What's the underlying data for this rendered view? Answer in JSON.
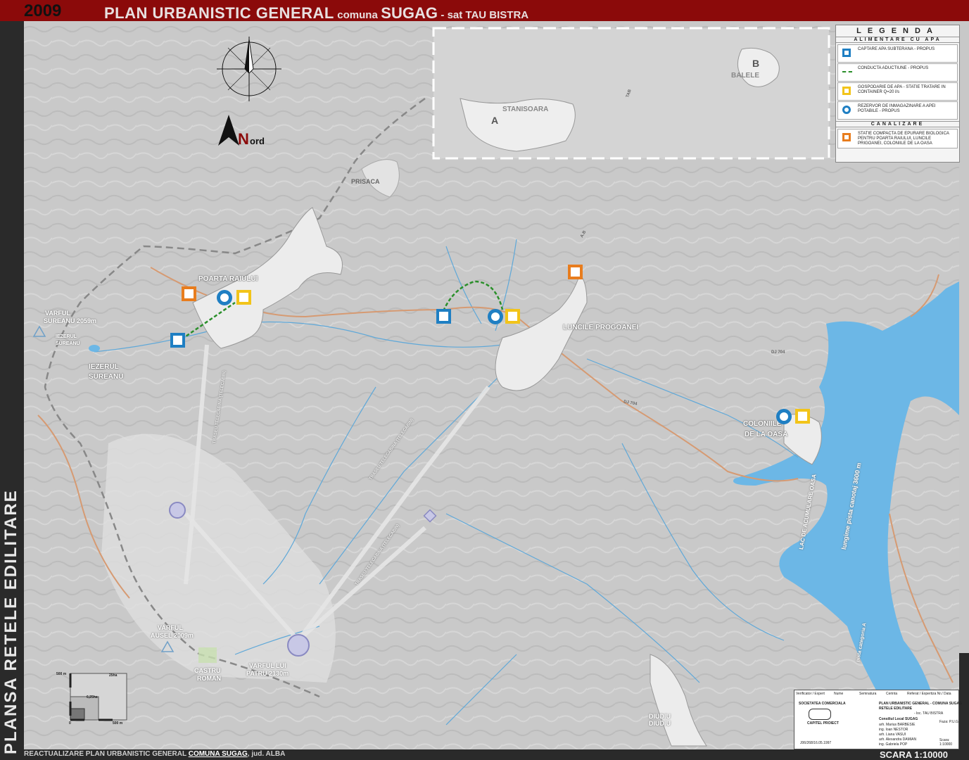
{
  "header": {
    "year": "2009",
    "title_main": "PLAN URBANISTIC GENERAL",
    "title_comuna_label": "comuna",
    "title_comuna": "SUGAG",
    "title_sat": "- sat TAU BISTRA"
  },
  "side_title": "PLANSA RETELE EDILITARE",
  "footer": {
    "left_prefix": "REACTUALIZARE PLAN URBANISTIC GENERAL",
    "left_comuna": "COMUNA SUGAG",
    "left_suffix": ", jud. ALBA",
    "scale": "SCARA 1:10000"
  },
  "legend": {
    "title": "LEGENDA",
    "section_water": "ALIMENTARE CU APA",
    "items_water": [
      {
        "icon": "blue-square-icon",
        "label": "CAPTARE APA SUBTERANA - PROPUS"
      },
      {
        "icon": "green-dashed-line-icon",
        "label": "CONDUCTA ADUCTIUNE - PROPUS"
      },
      {
        "icon": "yellow-square-icon",
        "label": "GOSPODARIE DE APA - STATIE TRATARE IN CONTAINER Q=20 l/s"
      },
      {
        "icon": "blue-circle-icon",
        "label": "REZERVOR DE INMAGAZINARE A APEI POTABILE - PROPUS"
      }
    ],
    "section_sewer": "CANALIZARE",
    "items_sewer": [
      {
        "icon": "orange-square-icon",
        "label": "STATIE COMPACTA DE EPURARE BIOLOGICA PENTRU POARTA RAIULUI, LUNCILE PRIGOANEI, COLONIILE DE LA OASA"
      }
    ]
  },
  "inset": {
    "area_a": "A",
    "area_a_name": "STANISOARA",
    "area_b": "B",
    "area_b_name": "BALELE",
    "road": "TAB"
  },
  "places": {
    "prisaca": "PRISACA",
    "poarta_raiului": "POARTA RAIULUI",
    "luncile_progoanei": "LUNCILE PROGOANEI",
    "coloniile": "COLONIILE",
    "de_la_oasa": "DE LA OASA",
    "varful_sureanu_1": "VARFUL",
    "varful_sureanu_2": "SUREANU 2059m",
    "iezerul_small_1": "IEZERUL",
    "iezerul_small_2": "SUREANU",
    "iezerul_1": "IEZERUL",
    "iezerul_2": "SUREANU",
    "varful_ausel_1": "VARFUL",
    "varful_ausel_2": "AUSEL 2009m",
    "castru_1": "CASTRU",
    "castru_2": "ROMAN",
    "varful_patru_1": "VARFUL LUI",
    "varful_patru_2": "PATRU 2130m",
    "diudiu_top": "DIUDIU",
    "diudiu_bottom": "DIUDIU",
    "lac": "LAC DE ACUMULARE OASA",
    "pista": "lungime pista canotaj 3600 m",
    "pista2": "pista categoria A",
    "road_dj704": "DJ 704",
    "road_dj704b": "DJ 704",
    "road_ab": "A.B",
    "telecabina1": "TRASEU TELECABINA (TELECABIN)",
    "telecabina2": "TRASEU TELECABINA (TELECABIN)",
    "telecabina3": "TRASEU TELECABINA (TELECABIN)"
  },
  "compass": {
    "north_letter": "N",
    "north_rest": "ord"
  },
  "scalebar": {
    "top_left": "500 m",
    "top_right": "25ha",
    "mid": "6,25ha",
    "bottom_zero": "0",
    "bottom_right": "500 m"
  },
  "titleblock": {
    "company": "SOCIETATEA COMERCIALA",
    "company_name": "CAPITEL PROIECT",
    "reg": "J06/268/16.05.1997",
    "project": "PLAN URBANISTIC GENERAL - COMUNA SUGAG",
    "subproject": "RETELE EDILITARE",
    "loc": "- loc. TAU BISTRA",
    "beneficiar": "Consiliul Local SUGAG",
    "scara_label": "Scara:",
    "scara_val": "1:10000",
    "faza": "Faza: P.U.G.",
    "row_verif": "Verificator / Expert",
    "row_nume": "Nume",
    "row_semn": "Semnatura",
    "row_cerinta": "Cerinta",
    "row_referat": "Referat / Expertiza Nr./ Data",
    "person1": "arh. Marius BARBESIE",
    "person2": "ing. Ioan NESTOR",
    "person3": "arh. Liana VASUI",
    "person4": "arh. Alexandra DAMIAN",
    "person5": "ing. Gabriela POP"
  },
  "colors": {
    "brand_red": "#8b0a0a",
    "water": "#6cb7e6",
    "marker_blue": "#1f7fc3",
    "marker_yellow": "#f2c41a",
    "marker_orange": "#e87d1e",
    "pipe_green": "#2a8f2a"
  }
}
